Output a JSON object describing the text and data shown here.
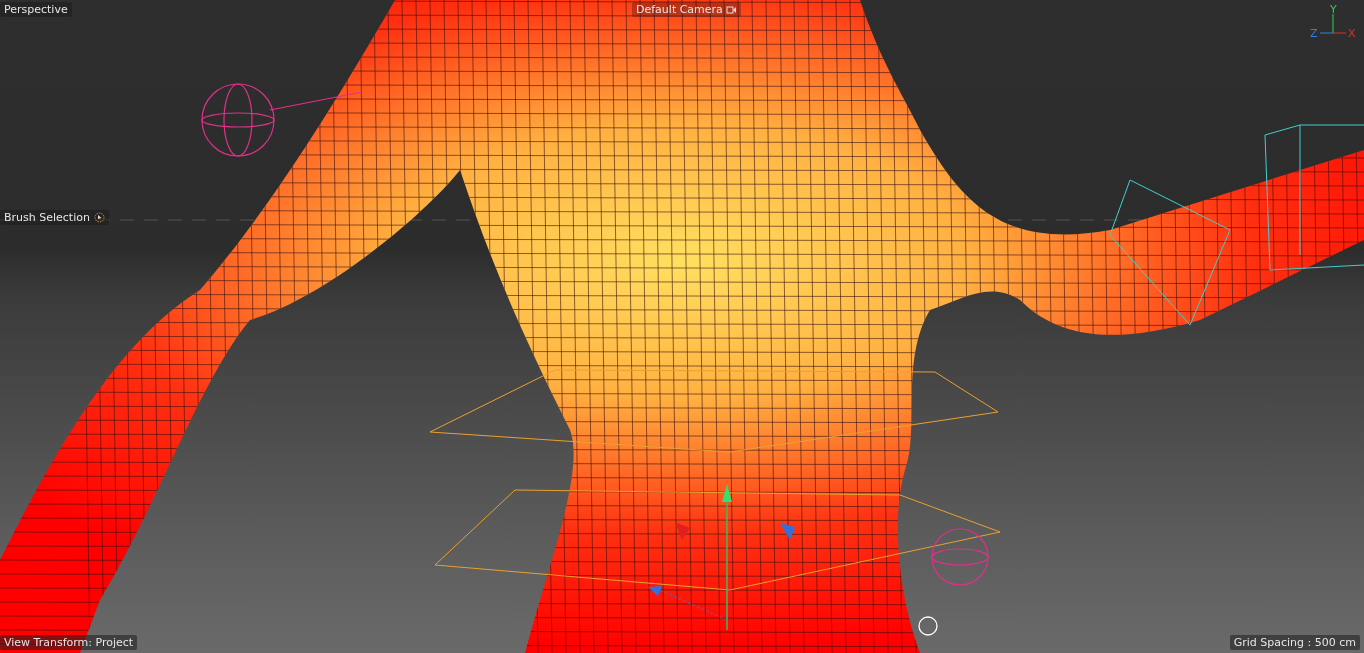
{
  "viewport": {
    "view_name": "Perspective",
    "camera": "Default Camera",
    "brush_mode": "Brush Selection",
    "view_transform": "View Transform: Project",
    "grid_spacing": "Grid Spacing : 500 cm"
  },
  "axis_gizmo": {
    "y_label": "Y",
    "z_label": "Z",
    "x_label": "X"
  }
}
